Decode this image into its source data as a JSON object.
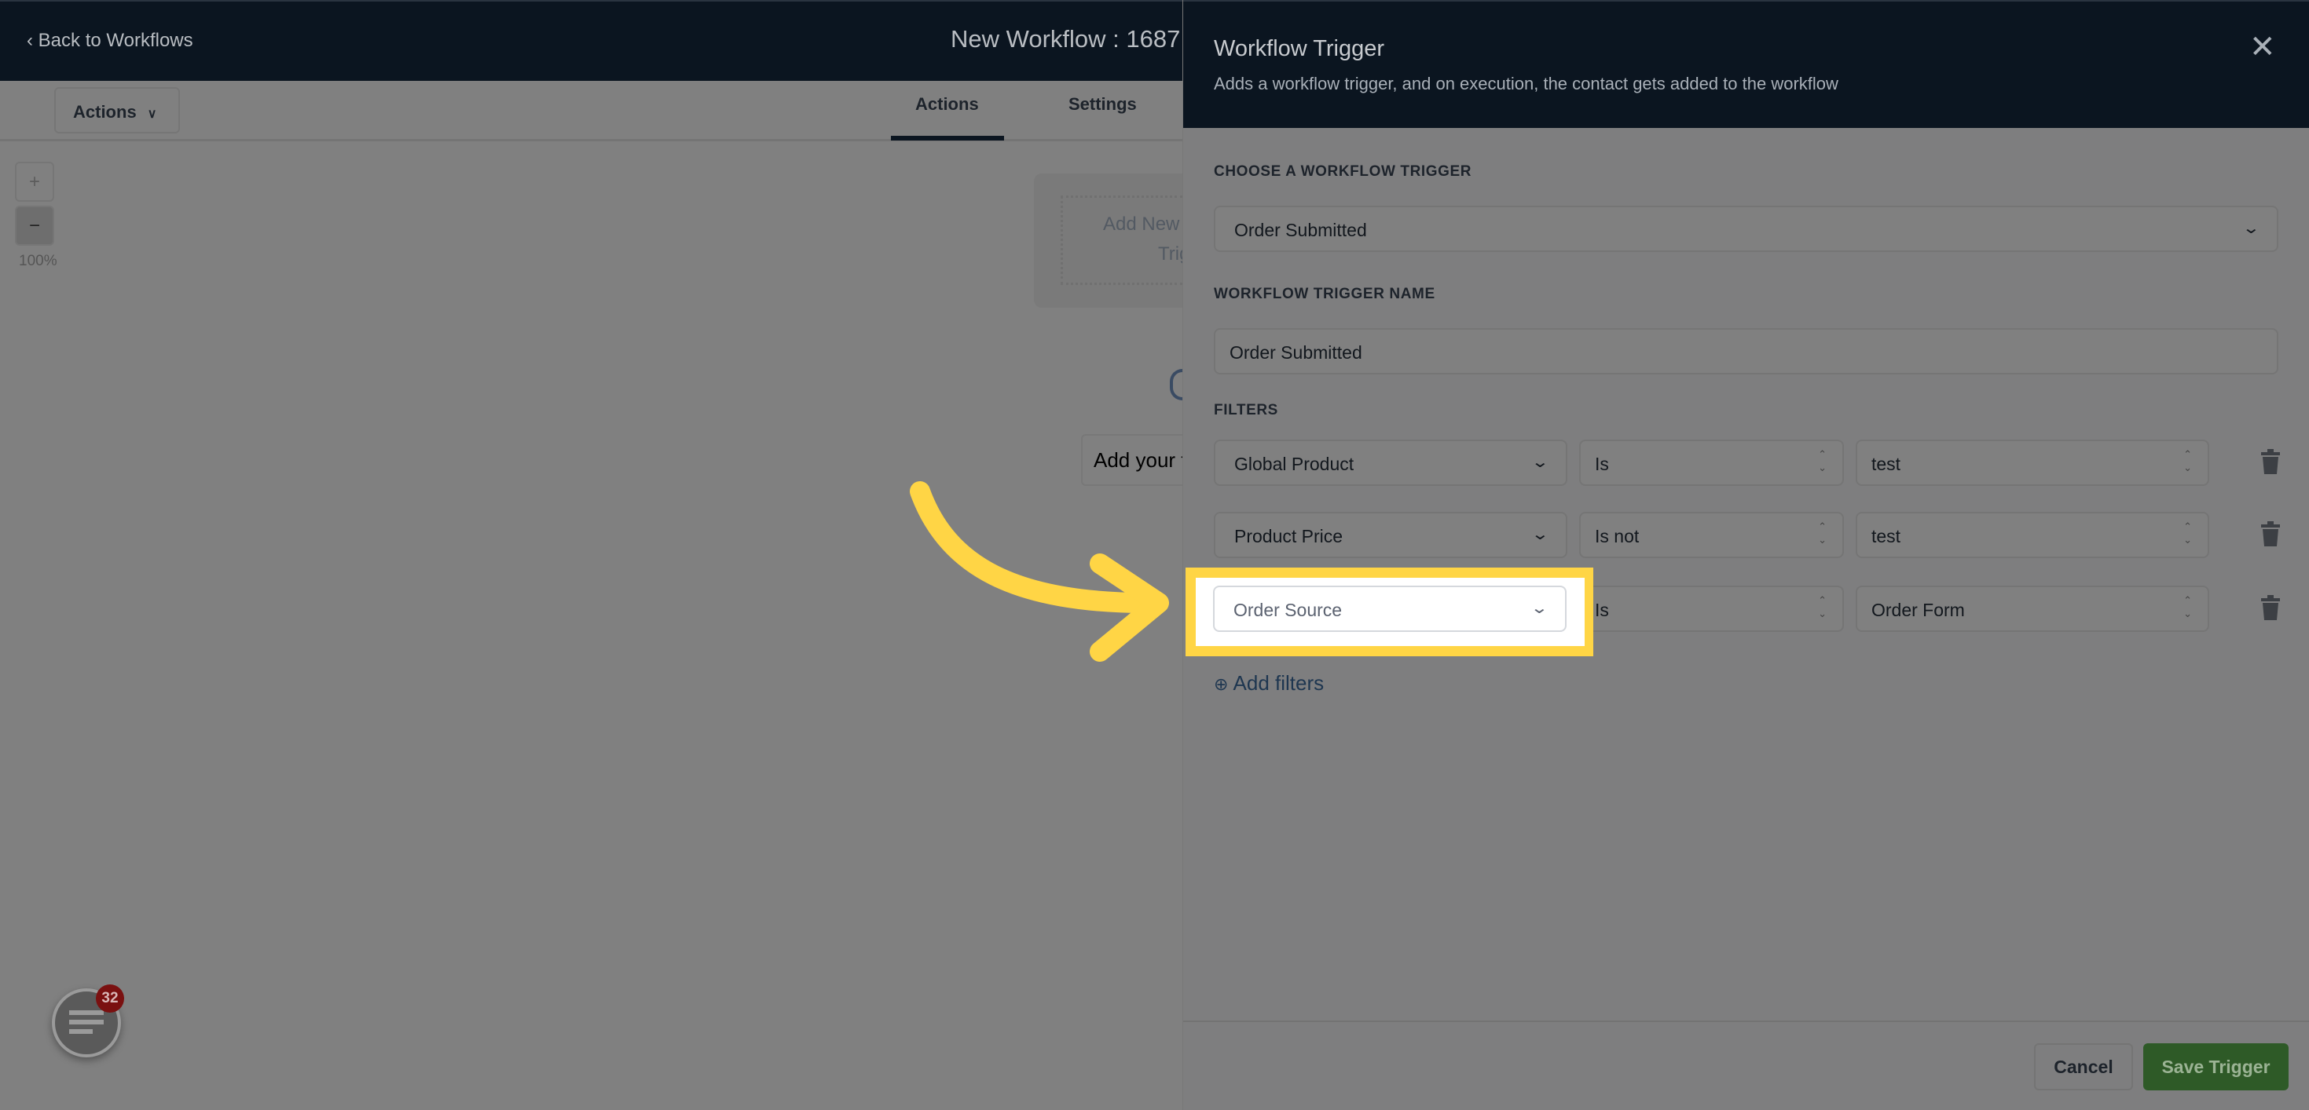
{
  "topbar": {
    "back_label": "Back to Workflows",
    "title": "New Workflow : 1687"
  },
  "toolbar": {
    "actions_dropdown": "Actions",
    "tabs": [
      {
        "label": "Actions",
        "active": true
      },
      {
        "label": "Settings",
        "active": false
      }
    ]
  },
  "canvas": {
    "zoom_in": "+",
    "zoom_out": "−",
    "zoom_level": "100%",
    "trigger_node_line1": "Add New",
    "trigger_node_line2": "Trig",
    "first_action_text": "Add your f"
  },
  "panel": {
    "title": "Workflow Trigger",
    "subtitle": "Adds a workflow trigger, and on execution, the contact gets added to the workflow",
    "trigger_label": "CHOOSE A WORKFLOW TRIGGER",
    "trigger_value": "Order Submitted",
    "name_label": "WORKFLOW TRIGGER NAME",
    "name_value": "Order Submitted",
    "filters_label": "FILTERS",
    "filters": [
      {
        "field": "Global Product",
        "operator": "Is",
        "value": "test"
      },
      {
        "field": "Product Price",
        "operator": "Is not",
        "value": "test"
      },
      {
        "field": "Order Source",
        "operator": "Is",
        "value": "Order Form",
        "highlighted": true
      }
    ],
    "add_filters": "Add filters",
    "cancel": "Cancel",
    "save": "Save Trigger"
  },
  "chat_widget": {
    "badge_count": "32"
  },
  "colors": {
    "highlight": "#ffd545",
    "save_button": "#2e5a27",
    "header": "#0b1520",
    "badge": "#7a1010"
  }
}
